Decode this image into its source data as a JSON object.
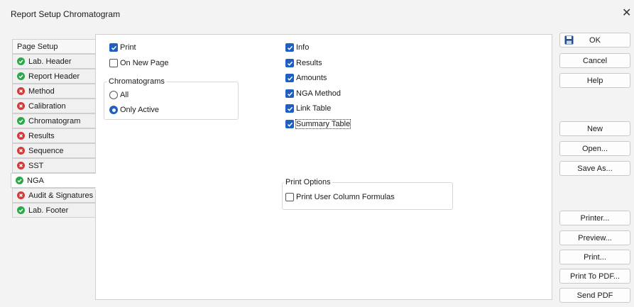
{
  "window": {
    "title": "Report Setup Chromatogram"
  },
  "tabs": [
    {
      "label": "Page Setup",
      "status": "none"
    },
    {
      "label": "Lab. Header",
      "status": "ok"
    },
    {
      "label": "Report Header",
      "status": "ok"
    },
    {
      "label": "Method",
      "status": "error"
    },
    {
      "label": "Calibration",
      "status": "error"
    },
    {
      "label": "Chromatogram",
      "status": "ok"
    },
    {
      "label": "Results",
      "status": "error"
    },
    {
      "label": "Sequence",
      "status": "error"
    },
    {
      "label": "SST",
      "status": "error"
    },
    {
      "label": "NGA",
      "status": "ok",
      "active": true
    },
    {
      "label": "Audit & Signatures",
      "status": "error"
    },
    {
      "label": "Lab. Footer",
      "status": "ok"
    }
  ],
  "panel": {
    "print": {
      "label": "Print",
      "checked": true
    },
    "on_new_page": {
      "label": "On New Page",
      "checked": false
    },
    "chromatograms": {
      "title": "Chromatograms",
      "options": [
        {
          "label": "All",
          "selected": false
        },
        {
          "label": "Only Active",
          "selected": true
        }
      ]
    },
    "sections": [
      {
        "label": "Info",
        "checked": true
      },
      {
        "label": "Results",
        "checked": true
      },
      {
        "label": "Amounts",
        "checked": true
      },
      {
        "label": "NGA Method",
        "checked": true
      },
      {
        "label": "Link Table",
        "checked": true
      },
      {
        "label": "Summary Table",
        "checked": true
      }
    ],
    "print_options": {
      "title": "Print Options",
      "user_column_formulas": {
        "label": "Print User Column Formulas",
        "checked": false
      }
    }
  },
  "buttons": {
    "ok": "OK",
    "cancel": "Cancel",
    "help": "Help",
    "new": "New",
    "open": "Open...",
    "save_as": "Save As...",
    "printer": "Printer...",
    "preview": "Preview...",
    "print": "Print...",
    "print_to_pdf": "Print To PDF...",
    "send_pdf": "Send PDF"
  },
  "colors": {
    "ok": "#2fa64a",
    "error": "#d43a3a",
    "checkbox": "#1f5fbf"
  }
}
